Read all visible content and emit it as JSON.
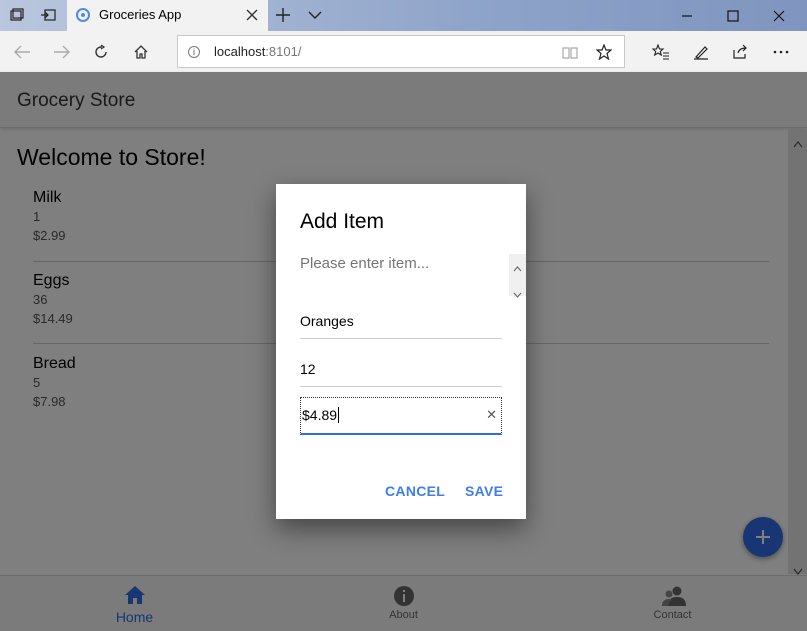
{
  "browser": {
    "tab_title": "Groceries App",
    "url": "localhost",
    "url_port": ":8101/"
  },
  "app": {
    "title": "Grocery Store",
    "welcome": "Welcome to Store!",
    "items": [
      {
        "name": "Milk",
        "quantity": "1",
        "price": "$2.99"
      },
      {
        "name": "Eggs",
        "quantity": "36",
        "price": "$14.49"
      },
      {
        "name": "Bread",
        "quantity": "5",
        "price": "$7.98"
      }
    ],
    "tabs": [
      {
        "label": "Home",
        "icon": "home-icon",
        "active": true
      },
      {
        "label": "About",
        "icon": "info-icon",
        "active": false
      },
      {
        "label": "Contact",
        "icon": "contacts-icon",
        "active": false
      }
    ]
  },
  "dialog": {
    "title": "Add Item",
    "message": "Please enter item...",
    "name_value": "Oranges",
    "quantity_value": "12",
    "price_value": "$4.89",
    "cancel_label": "CANCEL",
    "save_label": "SAVE"
  },
  "colors": {
    "accent": "#2e6ce6",
    "dialog_button": "#3f7de8",
    "titlebar": "#8ea3c9"
  }
}
